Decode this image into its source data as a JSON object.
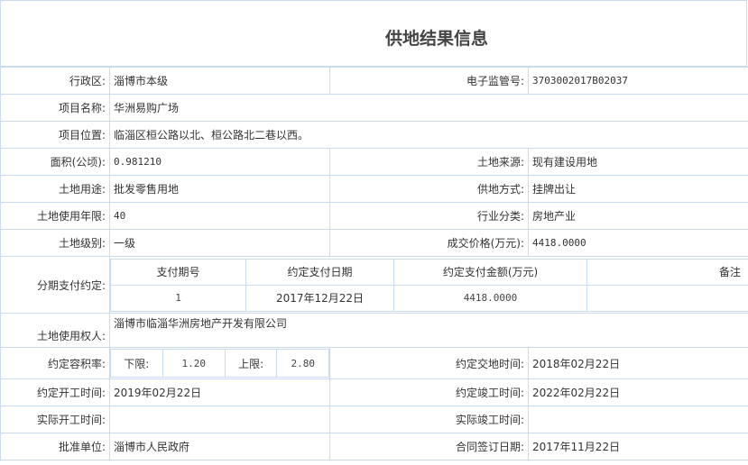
{
  "title": "供地结果信息",
  "fields": {
    "district_label": "行政区:",
    "district_value": "淄博市本级",
    "supervision_label": "电子监管号:",
    "supervision_value": "3703002017B02037",
    "project_name_label": "项目名称:",
    "project_name_value": "华洲易购广场",
    "project_location_label": "项目位置:",
    "project_location_value": "临淄区桓公路以北、桓公路北二巷以西。",
    "area_label": "面积(公顷):",
    "area_value": "0.981210",
    "land_source_label": "土地来源:",
    "land_source_value": "现有建设用地",
    "land_use_label": "土地用途:",
    "land_use_value": "批发零售用地",
    "supply_method_label": "供地方式:",
    "supply_method_value": "挂牌出让",
    "use_years_label": "土地使用年限:",
    "use_years_value": "40",
    "industry_label": "行业分类:",
    "industry_value": "房地产业",
    "land_grade_label": "土地级别:",
    "land_grade_value": "一级",
    "price_label": "成交价格(万元):",
    "price_value": "4418.0000",
    "installment_label": "分期支付约定:",
    "land_user_label": "土地使用权人:",
    "land_user_value": "淄博市临淄华洲房地产开发有限公司",
    "far_label": "约定容积率:",
    "far_lower_label": "下限:",
    "far_lower_value": "1.20",
    "far_upper_label": "上限:",
    "far_upper_value": "2.80",
    "delivery_time_label": "约定交地时间:",
    "delivery_time_value": "2018年02月22日",
    "planned_start_label": "约定开工时间:",
    "planned_start_value": "2019年02月22日",
    "planned_completion_label": "约定竣工时间:",
    "planned_completion_value": "2022年02月22日",
    "actual_start_label": "实际开工时间:",
    "actual_start_value": "",
    "actual_completion_label": "实际竣工时间:",
    "actual_completion_value": "",
    "approval_unit_label": "批准单位:",
    "approval_unit_value": "淄博市人民政府",
    "contract_date_label": "合同签订日期:",
    "contract_date_value": "2017年11月22日"
  },
  "installments": {
    "headers": [
      "支付期号",
      "约定支付日期",
      "约定支付金额(万元)",
      "备注"
    ],
    "rows": [
      [
        "1",
        "2017年12月22日",
        "4418.0000",
        ""
      ]
    ]
  },
  "colors": {
    "border": "#c9dcef",
    "text": "#333333",
    "title": "#444444"
  }
}
